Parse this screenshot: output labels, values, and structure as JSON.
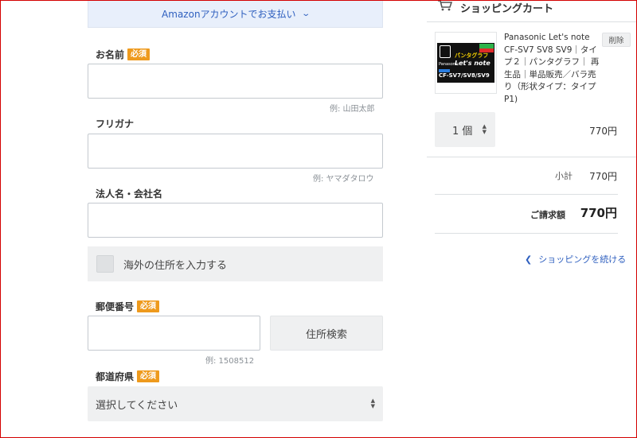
{
  "form": {
    "amazon_pay_label": "Amazonアカウントでお支払い",
    "required_badge": "必須",
    "name": {
      "label": "お名前",
      "value": "",
      "hint": "例: 山田太郎"
    },
    "furigana": {
      "label": "フリガナ",
      "value": "",
      "hint": "例: ヤマダタロウ"
    },
    "company": {
      "label": "法人名・会社名",
      "value": ""
    },
    "overseas_checkbox_label": "海外の住所を入力する",
    "postal": {
      "label": "郵便番号",
      "value": "",
      "hint": "例: 1508512",
      "search_button": "住所検索"
    },
    "prefecture": {
      "label": "都道府県",
      "selected": "選択してください"
    }
  },
  "cart": {
    "title": "ショッピングカート",
    "item": {
      "name": "Panasonic Let's note CF-SV7 SV8 SV9｜タイプ２｜パンタグラフ｜ 再生品｜単品販売／バラ売り（形状タイプ：タイプP1)",
      "delete_label": "削除",
      "quantity": "1 個",
      "price": "770円",
      "thumb_text_pantograph": "パンタグラフ",
      "thumb_text_brand": "Panasonic",
      "thumb_text_model": "Let's note",
      "thumb_text_series": "CF-SV7/SV8/SV9"
    },
    "subtotal_label": "小計",
    "subtotal_value": "770円",
    "total_label": "ご請求額",
    "total_value": "770円",
    "continue_label": "ショッピングを続ける"
  },
  "colors": {
    "accent_link": "#2e5fbf",
    "required_badge": "#ee9a1d",
    "frame_border": "#d40000"
  }
}
